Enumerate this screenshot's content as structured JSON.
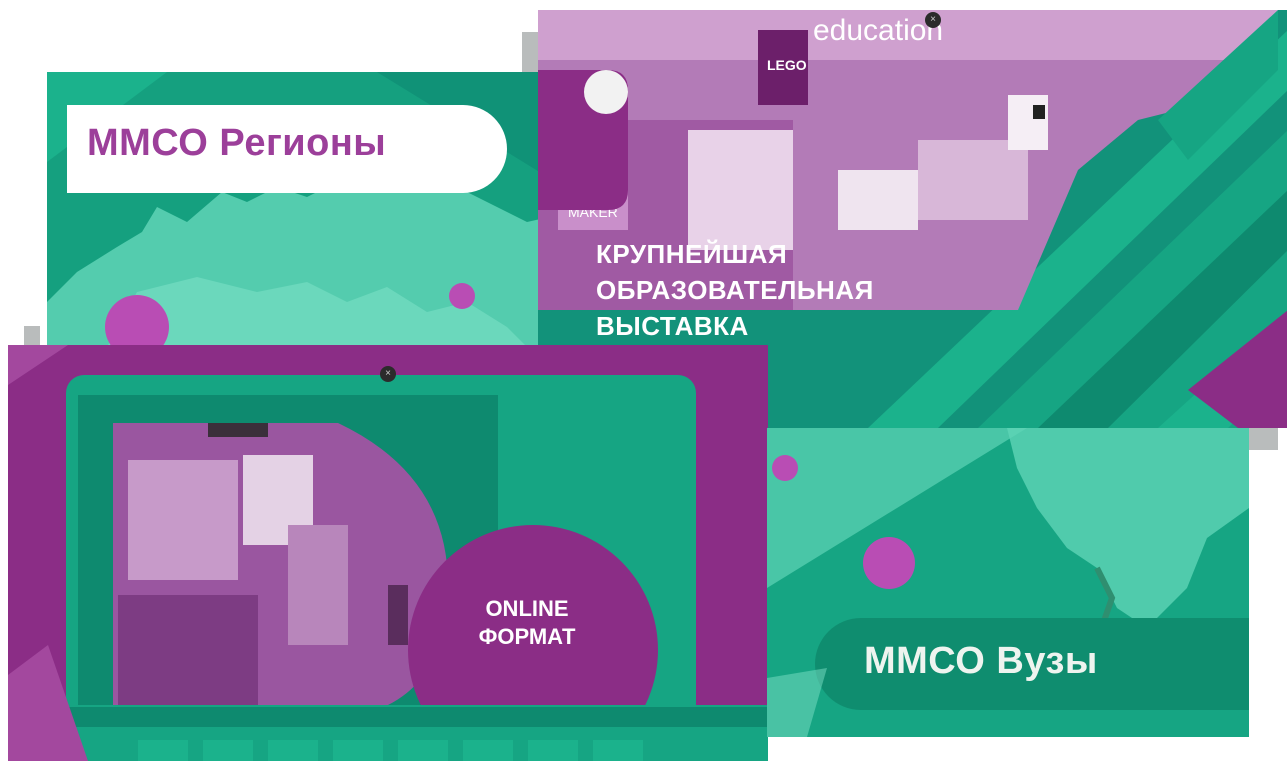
{
  "colors": {
    "green": "#15a07f",
    "dark_green": "#0e8a6f",
    "purple": "#8b2d86",
    "magenta_dot": "#b94db4",
    "white": "#ffffff"
  },
  "cards": {
    "regions": {
      "title": "ММСО Регионы",
      "icons": [
        "russia-map-icon"
      ]
    },
    "expo": {
      "heading_lines": [
        "КРУПНЕЙШАЯ",
        "ОБРАЗОВАТЕЛЬНАЯ",
        "ВЫСТАВКА"
      ],
      "photo_labels": [
        "education",
        "MAKER"
      ],
      "logo_text": "LEGO"
    },
    "online": {
      "label_lines": [
        "ONLINE",
        "ФОРМАТ"
      ]
    },
    "vuz": {
      "title": "ММСО Вузы",
      "icons": [
        "far-east-map-icon"
      ]
    }
  },
  "close_glyph": "×"
}
